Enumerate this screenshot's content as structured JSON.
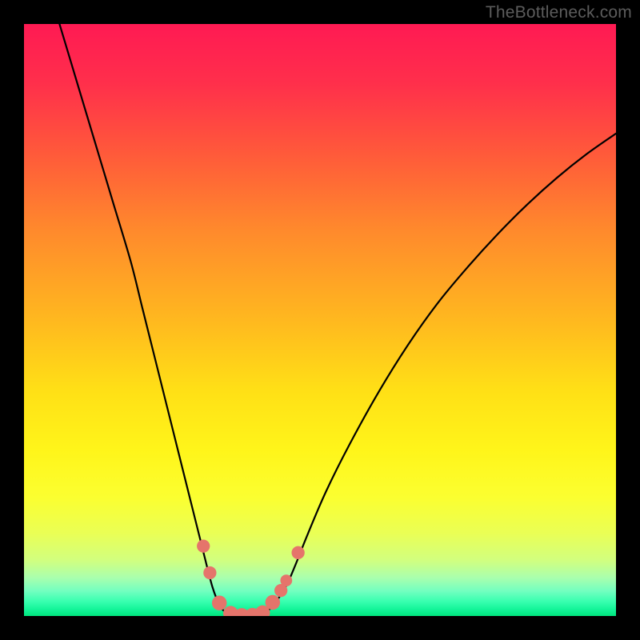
{
  "watermark": "TheBottleneck.com",
  "chart_data": {
    "type": "line",
    "title": "",
    "xlabel": "",
    "ylabel": "",
    "xlim": [
      0,
      100
    ],
    "ylim": [
      0,
      100
    ],
    "grid": false,
    "curves": [
      {
        "name": "left-arm",
        "points": [
          [
            6,
            100
          ],
          [
            9,
            90
          ],
          [
            12,
            80
          ],
          [
            15,
            70
          ],
          [
            18,
            60
          ],
          [
            20,
            52
          ],
          [
            22,
            44
          ],
          [
            24,
            36
          ],
          [
            26,
            28
          ],
          [
            27.5,
            22
          ],
          [
            29,
            16
          ],
          [
            30,
            12
          ],
          [
            31,
            8
          ],
          [
            31.8,
            5
          ],
          [
            32.5,
            3
          ],
          [
            33.2,
            1.5
          ],
          [
            34,
            0.7
          ],
          [
            35,
            0.3
          ],
          [
            36,
            0.1
          ],
          [
            37,
            0.0
          ]
        ]
      },
      {
        "name": "right-arm",
        "points": [
          [
            37,
            0.0
          ],
          [
            38,
            0.0
          ],
          [
            39,
            0.1
          ],
          [
            40,
            0.3
          ],
          [
            41,
            0.8
          ],
          [
            42,
            1.6
          ],
          [
            43,
            3
          ],
          [
            44.5,
            5.5
          ],
          [
            46,
            9
          ],
          [
            48,
            14
          ],
          [
            51,
            21
          ],
          [
            55,
            29
          ],
          [
            60,
            38
          ],
          [
            65,
            46
          ],
          [
            70,
            53
          ],
          [
            75,
            59
          ],
          [
            80,
            64.5
          ],
          [
            85,
            69.5
          ],
          [
            90,
            74
          ],
          [
            95,
            78
          ],
          [
            100,
            81.5
          ]
        ]
      }
    ],
    "markers": [
      {
        "x": 30.3,
        "y": 11.8,
        "r": 1.1
      },
      {
        "x": 31.4,
        "y": 7.3,
        "r": 1.1
      },
      {
        "x": 33.0,
        "y": 2.2,
        "r": 1.25
      },
      {
        "x": 34.9,
        "y": 0.45,
        "r": 1.25
      },
      {
        "x": 36.8,
        "y": 0.08,
        "r": 1.25
      },
      {
        "x": 38.6,
        "y": 0.12,
        "r": 1.25
      },
      {
        "x": 40.3,
        "y": 0.55,
        "r": 1.25
      },
      {
        "x": 42.0,
        "y": 2.3,
        "r": 1.25
      },
      {
        "x": 43.4,
        "y": 4.3,
        "r": 1.1
      },
      {
        "x": 44.3,
        "y": 6.0,
        "r": 1.0
      },
      {
        "x": 46.3,
        "y": 10.7,
        "r": 1.1
      }
    ],
    "marker_color": "#e5746b",
    "background_gradient": {
      "stops": [
        {
          "offset": 0.0,
          "color": "#ff1a53"
        },
        {
          "offset": 0.1,
          "color": "#ff2f4b"
        },
        {
          "offset": 0.22,
          "color": "#ff5a3a"
        },
        {
          "offset": 0.35,
          "color": "#ff8a2c"
        },
        {
          "offset": 0.5,
          "color": "#ffb81f"
        },
        {
          "offset": 0.62,
          "color": "#ffe016"
        },
        {
          "offset": 0.72,
          "color": "#fff51a"
        },
        {
          "offset": 0.8,
          "color": "#fbff30"
        },
        {
          "offset": 0.86,
          "color": "#eaff55"
        },
        {
          "offset": 0.905,
          "color": "#d2ff7e"
        },
        {
          "offset": 0.935,
          "color": "#aaffad"
        },
        {
          "offset": 0.958,
          "color": "#72ffc0"
        },
        {
          "offset": 0.975,
          "color": "#3affb0"
        },
        {
          "offset": 0.988,
          "color": "#15f59a"
        },
        {
          "offset": 1.0,
          "color": "#00e57e"
        }
      ]
    }
  }
}
